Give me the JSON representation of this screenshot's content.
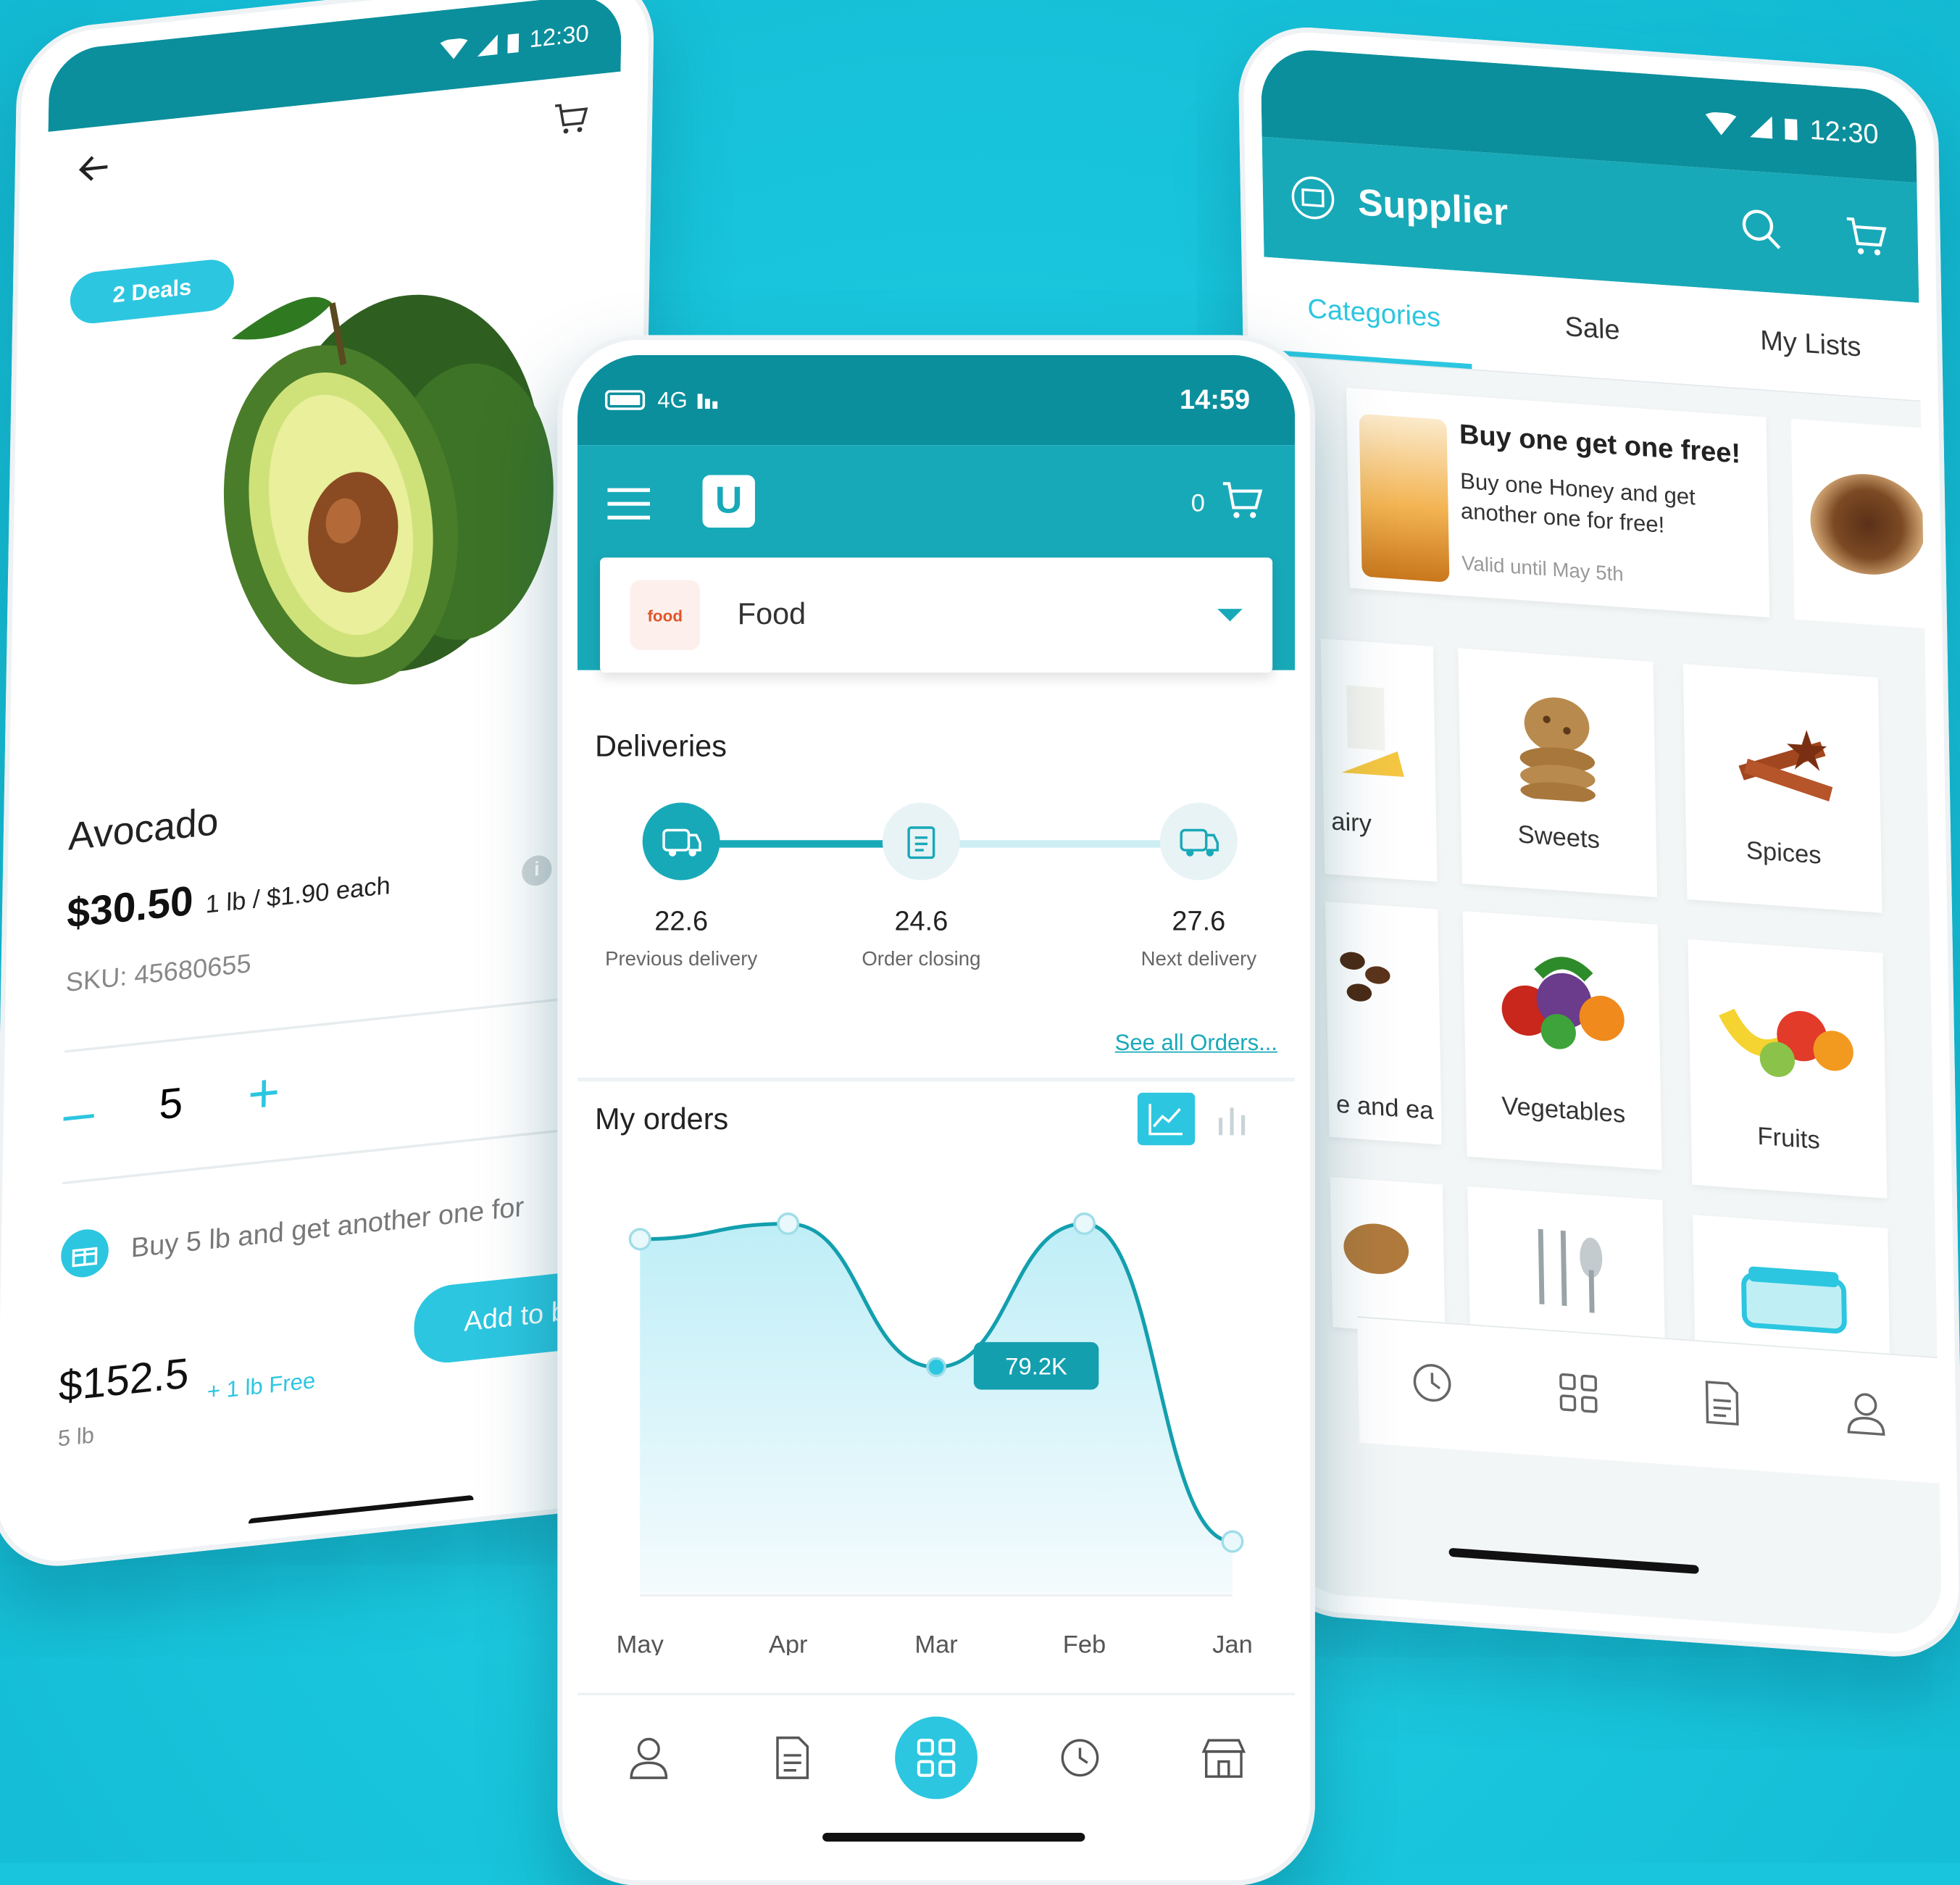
{
  "colors": {
    "background": "#18c5dc",
    "accent": "#2cc6e0",
    "header": "#18a9b8",
    "statusbar": "#0b8f9c"
  },
  "left_phone": {
    "status_time": "12:30",
    "deals_badge": "2 Deals",
    "product_name": "Avocado",
    "price": "$30.50",
    "unit_price": "1 lb / $1.90 each",
    "sku": "SKU: 45680655",
    "info_icon": "i",
    "quantity": "5",
    "minus": "–",
    "plus": "+",
    "promo_text": "Buy 5 lb and get another one for",
    "total": "$152.5",
    "total_weight": "5 lb",
    "free_text": "+ 1 lb Free",
    "add_button": "Add to b"
  },
  "right_phone": {
    "status_time": "12:30",
    "title": "Supplier",
    "tabs": [
      {
        "label": "Categories"
      },
      {
        "label": "Sale"
      },
      {
        "label": "My Lists"
      }
    ],
    "active_tab": "Categories",
    "banner": {
      "title": "Buy one get one free!",
      "text": "Buy one Honey and get another one for free!",
      "valid": "Valid until May 5th"
    },
    "categories": [
      {
        "label": "airy"
      },
      {
        "label": "Sweets"
      },
      {
        "label": "Spices"
      },
      {
        "label": "e and ea"
      },
      {
        "label": "Vegetables"
      },
      {
        "label": "Fruits"
      },
      {
        "label": ""
      },
      {
        "label": ""
      },
      {
        "label": ""
      }
    ],
    "nav_icons": [
      "history-icon",
      "grid-icon",
      "document-icon",
      "user-icon"
    ]
  },
  "center_phone": {
    "status_network": "4G",
    "status_time": "14:59",
    "logo": "U",
    "cart_count": "0",
    "selector_logo": "food",
    "selector_value": "Food",
    "deliveries_title": "Deliveries",
    "deliveries": [
      {
        "value": "22.6",
        "label": "Previous delivery",
        "state": "active"
      },
      {
        "value": "24.6",
        "label": "Order closing",
        "state": "pending"
      },
      {
        "value": "27.6",
        "label": "Next delivery",
        "state": "pending"
      }
    ],
    "see_all": "See all Orders...",
    "orders_title": "My orders",
    "nav_icons": [
      "user-icon",
      "document-icon",
      "grid-icon",
      "history-icon",
      "store-icon"
    ],
    "active_nav": "grid-icon"
  },
  "chart_data": {
    "type": "area",
    "categories": [
      "May",
      "Apr",
      "Mar",
      "Feb",
      "Jan"
    ],
    "highlight_label": "79.2K",
    "highlight_index": 2,
    "relative_values": [
      0.88,
      0.92,
      0.55,
      0.92,
      0.1
    ],
    "title": "My orders",
    "xlabel": "",
    "ylabel": "",
    "grid": false
  }
}
